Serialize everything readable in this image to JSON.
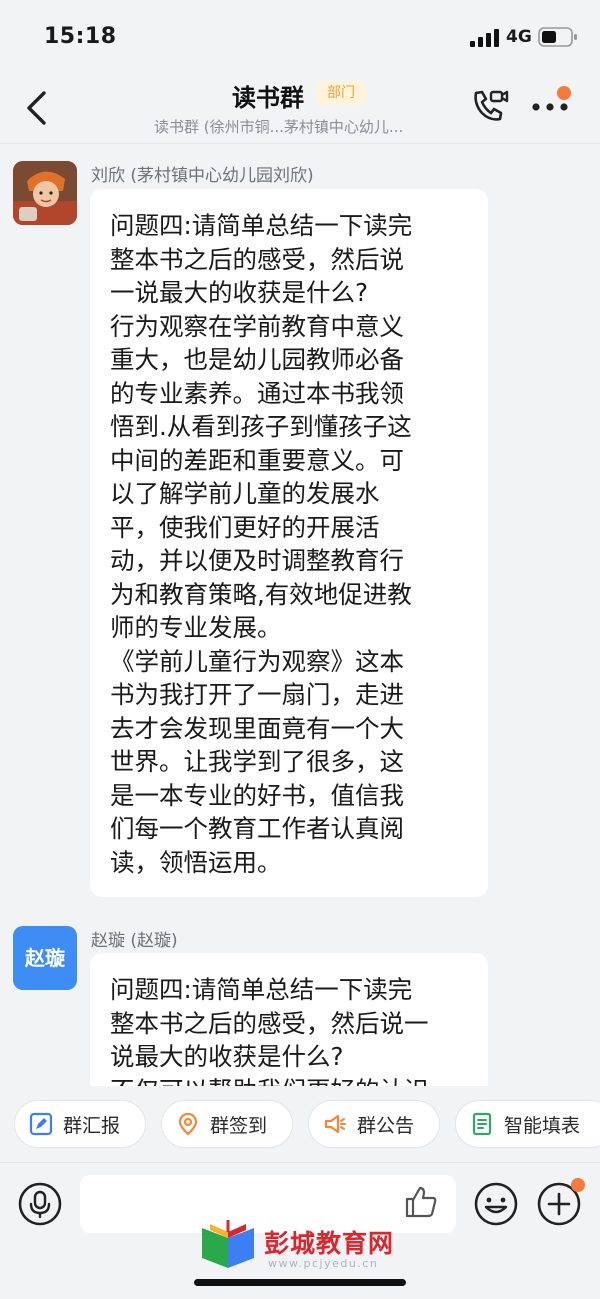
{
  "status_bar": {
    "time": "15:18",
    "network": "4G"
  },
  "header": {
    "title": "读书群",
    "badge": "部门",
    "subtitle": "读书群 (徐州市铜...茅村镇中心幼儿...",
    "icons": [
      "back-chevron-icon",
      "video-call-icon",
      "more-dots-icon"
    ]
  },
  "messages": [
    {
      "sender": "刘欣 (茅村镇中心幼儿园刘欣)",
      "avatar": "photo",
      "text": "问题四:请简单总结一下读完\n整本书之后的感受，然后说\n一说最大的收获是什么?\n行为观察在学前教育中意义\n重大，也是幼儿园教师必备\n的专业素养。通过本书我领\n悟到.从看到孩子到懂孩子这\n中间的差距和重要意义。可\n以了解学前儿童的发展水\n平，使我们更好的开展活\n动，并以便及时调整教育行\n为和教育策略,有效地促进教\n师的专业发展。\n《学前儿童行为观察》这本\n书为我打开了一扇门，走进\n去才会发现里面竟有一个大\n世界。让我学到了很多，这\n是一本专业的好书，值信我\n们每一个教育工作者认真阅\n读，领悟运用。"
    },
    {
      "sender": "赵璇 (赵璇)",
      "avatar_text": "赵璇",
      "text": "问题四:请简单总结一下读完\n整本书之后的感受，然后说一\n说最大的收获是什么?\n不仅可以帮助我们更好的认识"
    }
  ],
  "quick_actions": [
    {
      "label": "群汇报",
      "icon": "report-icon",
      "color": "#3d7ef5"
    },
    {
      "label": "群签到",
      "icon": "location-pin-icon",
      "color": "#f08a3a"
    },
    {
      "label": "群公告",
      "icon": "megaphone-icon",
      "color": "#f08a3a"
    },
    {
      "label": "智能填表",
      "icon": "form-icon",
      "color": "#2fa866"
    }
  ],
  "input_bar": {
    "icons": [
      "voice-icon",
      "thumbs-up-icon",
      "emoji-icon",
      "plus-icon"
    ]
  },
  "watermark": {
    "name": "彭城教育网",
    "url": "www.pcjyedu.cn"
  },
  "colors": {
    "accent_orange": "#f57a3b",
    "badge_text": "#e8a33b",
    "avatar_blue": "#3d8df5"
  }
}
